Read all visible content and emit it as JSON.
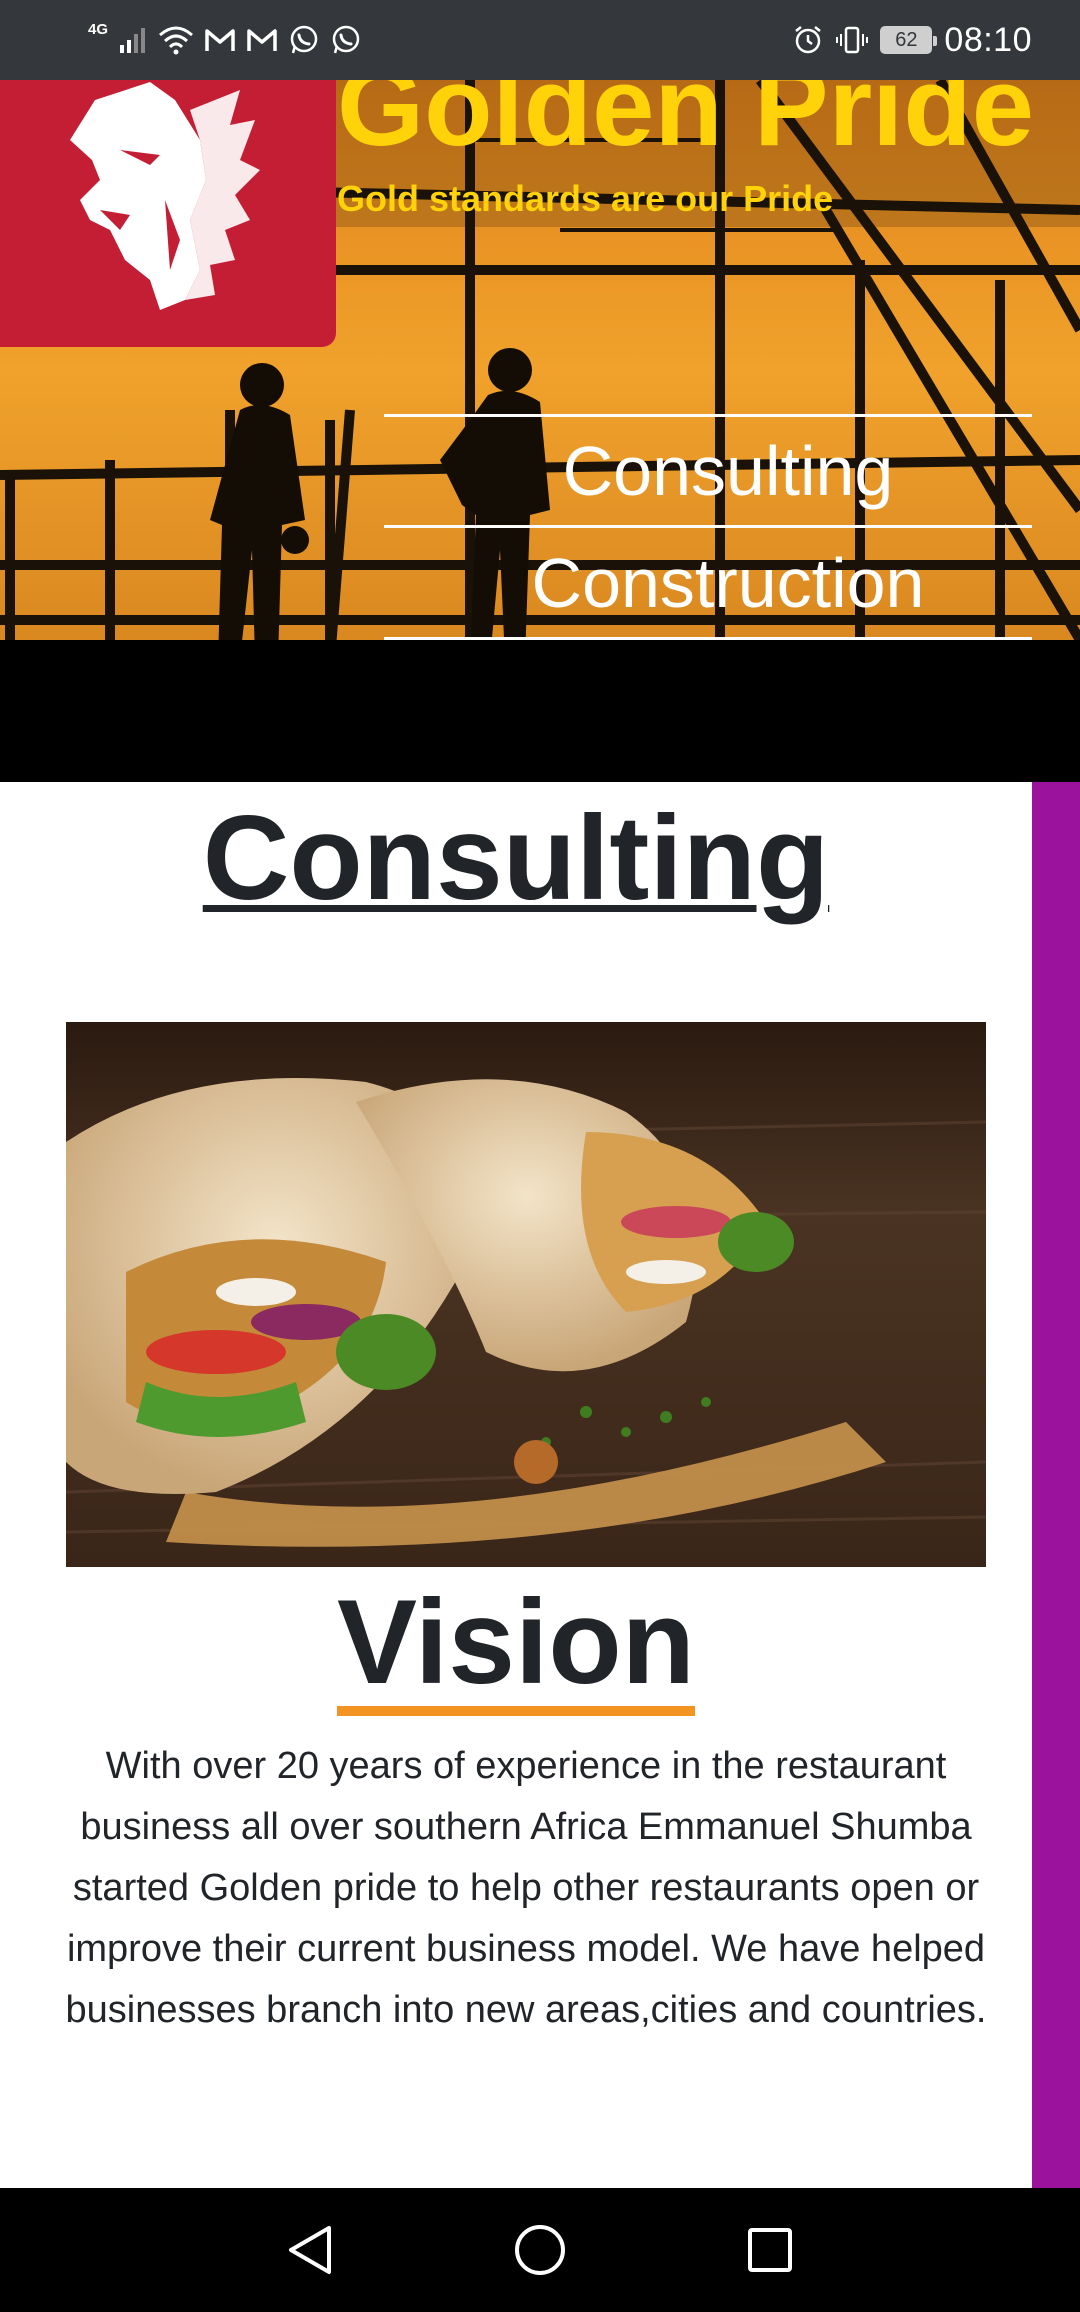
{
  "status_bar": {
    "network": "4G",
    "battery_level": "62",
    "time": "08:10",
    "icons": [
      "signal-icon",
      "wifi-icon",
      "gmail-icon",
      "gmail-icon",
      "whatsapp-icon",
      "whatsapp-icon",
      "alarm-icon",
      "vibrate-icon",
      "battery-icon"
    ]
  },
  "hero": {
    "brand_title": "Golden Pride",
    "tagline": "Gold standards are our Pride",
    "logo": "lion-head-logo",
    "nav_items": [
      "Consulting",
      "Construction"
    ],
    "colors": {
      "brand_yellow": "#ffd20a",
      "logo_red": "#c41e35",
      "sky_orange": "#e8961f"
    }
  },
  "content": {
    "heading": "Consulting",
    "image_subject": "food-wraps-photo",
    "vision_heading": "Vision",
    "vision_text": "With over 20 years of experience in the restaurant business all over southern Africa Emmanuel Shumba started Golden pride to help other restaurants open or improve their current business model. We have helped businesses branch into new areas,cities and countries.",
    "colors": {
      "accent_underline": "#f39322",
      "sidebar_purple": "#9b139d",
      "text": "#212529"
    }
  },
  "nav_bar": {
    "buttons": [
      "back-icon",
      "home-icon",
      "recents-icon"
    ]
  }
}
